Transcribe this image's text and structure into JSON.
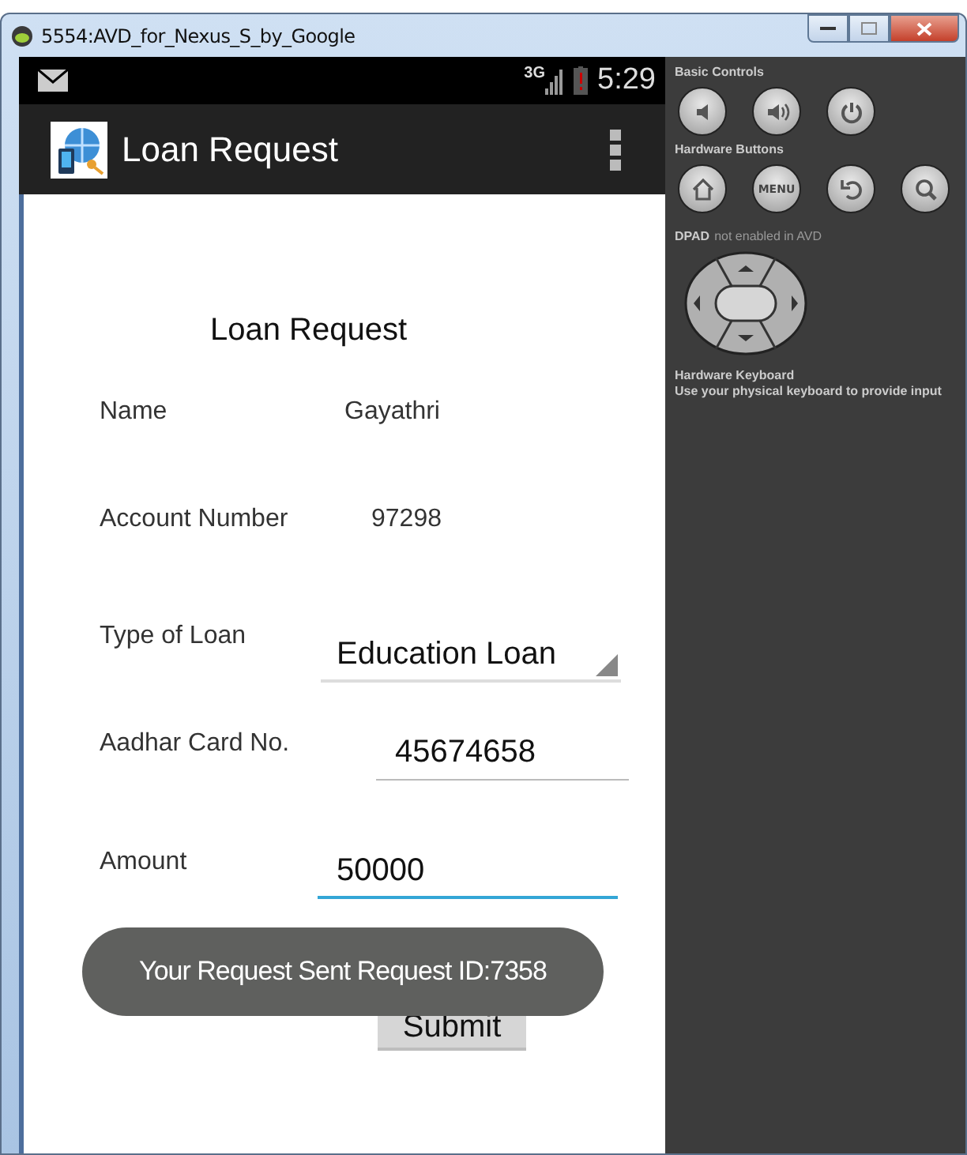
{
  "window": {
    "title": "5554:AVD_for_Nexus_S_by_Google"
  },
  "status_bar": {
    "network": "3G",
    "time": "5:29"
  },
  "action_bar": {
    "title": "Loan Request"
  },
  "form": {
    "heading": "Loan Request",
    "fields": [
      {
        "kind": "text",
        "label": "Name",
        "value": "Gayathri"
      },
      {
        "kind": "text",
        "label": "Account Number",
        "value": "97298"
      },
      {
        "kind": "dropdown",
        "label": "Type of Loan",
        "value": "Education Loan"
      },
      {
        "kind": "input",
        "label": "Aadhar Card No.",
        "value": "45674658",
        "focused": false
      },
      {
        "kind": "input",
        "label": "Amount",
        "value": "50000",
        "focused": true
      }
    ],
    "submit": "Submit"
  },
  "toast": "Your Request Sent Request ID:7358",
  "panel": {
    "basic_controls": "Basic Controls",
    "hardware_buttons": "Hardware Buttons",
    "menu_label": "MENU",
    "dpad": {
      "title": "DPAD",
      "note": "not enabled in AVD"
    },
    "keyboard": {
      "title": "Hardware Keyboard",
      "note": "Use your physical keyboard to provide input"
    }
  }
}
